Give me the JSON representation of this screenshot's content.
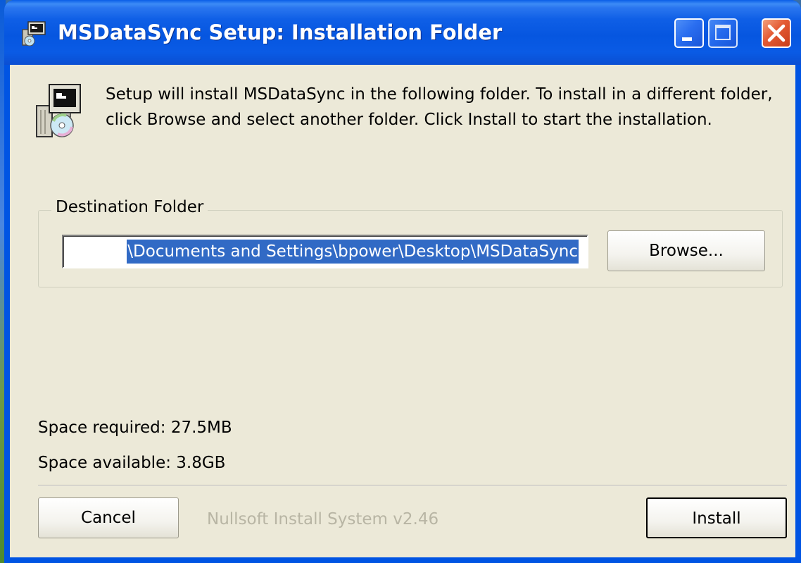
{
  "window": {
    "title": "MSDataSync Setup: Installation Folder"
  },
  "intro": {
    "text": "Setup will install MSDataSync in the following folder. To install in a different folder, click Browse and select another folder. Click Install to start the installation."
  },
  "destination": {
    "legend": "Destination Folder",
    "value": "\\Documents and Settings\\bpower\\Desktop\\MSDataSync",
    "browse_label": "Browse..."
  },
  "space": {
    "required": "Space required: 27.5MB",
    "available": "Space available: 3.8GB"
  },
  "footer": {
    "cancel_label": "Cancel",
    "branding": "Nullsoft Install System v2.46",
    "install_label": "Install"
  },
  "icons": {
    "app": "installer-app-icon",
    "setup": "setup-package-icon",
    "minimize": "minimize-icon",
    "maximize": "maximize-icon",
    "close": "close-icon"
  },
  "colors": {
    "titlebar": "#0054e3",
    "client_bg": "#ece9d8",
    "selection": "#316ac5",
    "close_button": "#e45a33"
  }
}
